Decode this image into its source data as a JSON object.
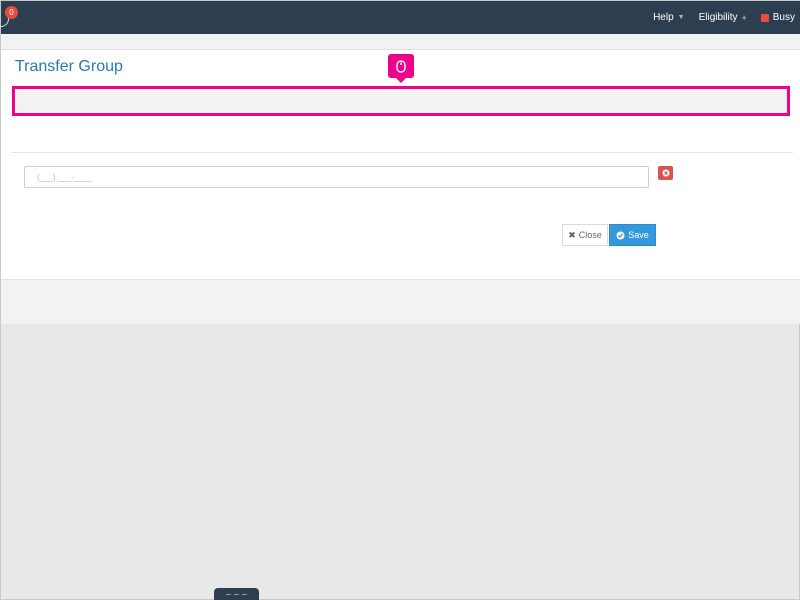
{
  "navbar": {
    "notification_count": "0",
    "help_label": "Help",
    "eligibility_label": "Eligibility",
    "eligibility_indicator": "+",
    "status_label": "Busy",
    "status_color": "#e74c3c",
    "background_color": "#2c3e50"
  },
  "modal": {
    "title": "Transfer Group",
    "mouse_marker_icon": "mouse-icon",
    "highlight_color": "#ec008c",
    "phone_input": {
      "value": "",
      "placeholder": "(___) ___-____"
    },
    "remove_icon": "remove-circle-icon",
    "close_label": "Close",
    "close_icon": "times-icon",
    "save_label": "Save",
    "save_icon": "check-circle-icon",
    "accent_color": "#3498db"
  }
}
